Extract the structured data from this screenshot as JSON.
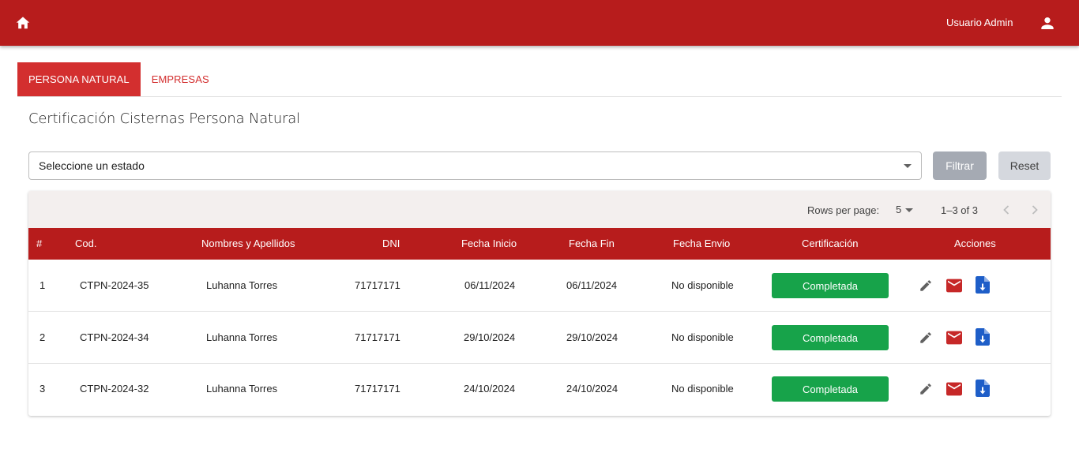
{
  "header": {
    "user_name": "Usuario Admin",
    "home_icon": "home-icon",
    "user_icon": "person-icon",
    "bar_color": "#b71c1c"
  },
  "tabs": [
    {
      "label": "PERSONA NATURAL",
      "active": true
    },
    {
      "label": "EMPRESAS",
      "active": false
    }
  ],
  "page_title": "Certificación Cisternas Persona Natural",
  "filter": {
    "select_value": "Seleccione un estado",
    "filter_label": "Filtrar",
    "reset_label": "Reset"
  },
  "pagination": {
    "rows_per_page_label": "Rows per page:",
    "rows_per_page_value": "5",
    "range": "1–3 of 3"
  },
  "table": {
    "columns": [
      "#",
      "Cod.",
      "Nombres y Apellidos",
      "DNI",
      "Fecha Inicio",
      "Fecha Fin",
      "Fecha Envio",
      "Certificación",
      "Acciones"
    ],
    "rows": [
      {
        "num": "1",
        "cod": "CTPN-2024-35",
        "nombre": "Luhanna Torres",
        "dni": "71717171",
        "inicio": "06/11/2024",
        "fin": "06/11/2024",
        "envio": "No disponible",
        "estado": "Completada"
      },
      {
        "num": "2",
        "cod": "CTPN-2024-34",
        "nombre": "Luhanna Torres",
        "dni": "71717171",
        "inicio": "29/10/2024",
        "fin": "29/10/2024",
        "envio": "No disponible",
        "estado": "Completada"
      },
      {
        "num": "3",
        "cod": "CTPN-2024-32",
        "nombre": "Luhanna Torres",
        "dni": "71717171",
        "inicio": "24/10/2024",
        "fin": "24/10/2024",
        "envio": "No disponible",
        "estado": "Completada"
      }
    ],
    "action_icons": [
      "edit-icon",
      "mail-icon",
      "download-file-icon"
    ],
    "status_color": "#17a34a"
  }
}
